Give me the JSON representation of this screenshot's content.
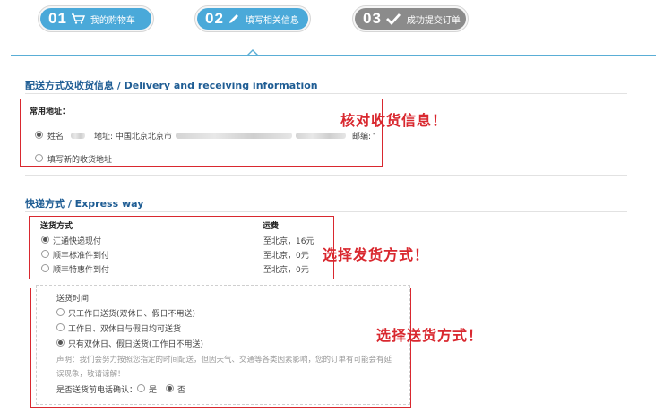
{
  "steps": [
    {
      "num": "01",
      "label": "我的购物车",
      "icon": "cart-icon"
    },
    {
      "num": "02",
      "label": "填写相关信息",
      "icon": "pencil-icon"
    },
    {
      "num": "03",
      "label": "成功提交订单",
      "icon": "check-icon"
    }
  ],
  "address_section": {
    "title": "配送方式及收货信息 / Delivery and receiving information",
    "common_label": "常用地址：",
    "address_option": {
      "name_label": "姓名:",
      "addr_label": "地址: 中国北京北京市",
      "zip_label": "邮编:",
      "tail": "-"
    },
    "new_address_label": "填写新的收货地址",
    "annotation": "核对收货信息！"
  },
  "express_section": {
    "title": "快递方式 / Express way",
    "col_method": "送货方式",
    "col_fee": "运费",
    "options": [
      {
        "label": "汇通快递现付",
        "fee": "至北京，16元",
        "selected": true
      },
      {
        "label": "顺丰标准件到付",
        "fee": "至北京，0元",
        "selected": false
      },
      {
        "label": "顺丰特惠件到付",
        "fee": "至北京，0元",
        "selected": false
      }
    ],
    "annotation": "选择发货方式！"
  },
  "delivery_time": {
    "label": "送货时间:",
    "options": [
      {
        "label": "只工作日送货(双休日、假日不用送)",
        "selected": false
      },
      {
        "label": "工作日、双休日与假日均可送货",
        "selected": false
      },
      {
        "label": "只有双休日、假日送货(工作日不用送)",
        "selected": true
      }
    ],
    "notice_line1": "声明：我们会努力按照您指定的时间配送，但因天气、交通等各类因素影响，您的订单有可能会有延",
    "notice_line2": "误现象，敬请谅解！",
    "confirm_label": "是否送货前电话确认：",
    "confirm_yes": "是",
    "confirm_no": "否",
    "annotation": "选择送货方式！"
  },
  "colors": {
    "accent": "#4aa9d9",
    "inactive": "#8b8b8b",
    "annotation": "#d9282f",
    "title": "#1f5d94"
  }
}
